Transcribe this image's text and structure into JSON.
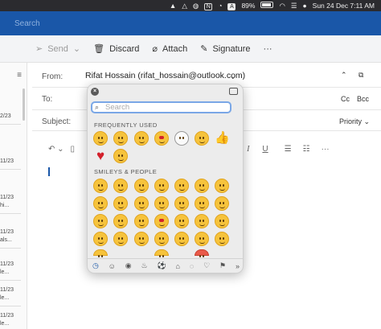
{
  "menubar": {
    "battery": "89%",
    "datetime": "Sun 24 Dec  7:11 AM"
  },
  "search": {
    "placeholder": "Search"
  },
  "toolbar": {
    "send": "Send",
    "discard": "Discard",
    "attach": "Attach",
    "signature": "Signature",
    "more": "···"
  },
  "leftpane": {
    "rows": [
      "2/23",
      "11/23",
      "11/23\nhi...",
      "11/23\nals...",
      "11/23\nle...",
      "11/23\nle...",
      "11/23\nle..."
    ]
  },
  "compose": {
    "from_label": "From:",
    "from_value": "Rifat Hossain (rifat_hossain@outlook.com)",
    "to_label": "To:",
    "cc": "Cc",
    "bcc": "Bcc",
    "subject_label": "Subject:",
    "priority": "Priority"
  },
  "emoji_picker": {
    "search_placeholder": "Search",
    "section_frequent": "FREQUENTLY USED",
    "section_smileys": "SMILEYS & PEOPLE"
  }
}
